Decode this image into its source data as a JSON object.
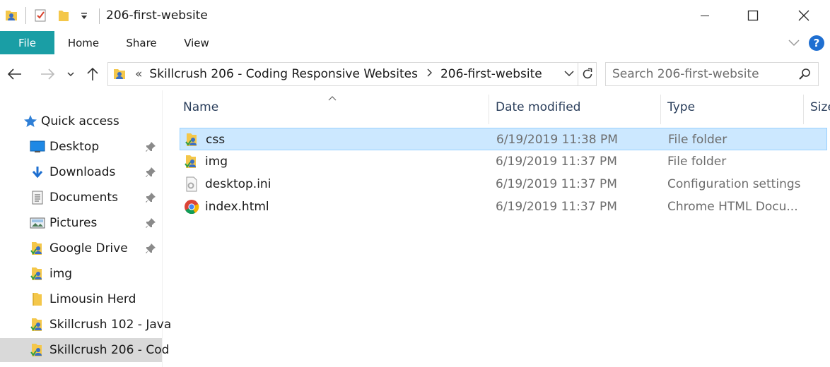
{
  "window": {
    "title": "206-first-website"
  },
  "ribbon": {
    "tabs": [
      "File",
      "Home",
      "Share",
      "View"
    ],
    "help_label": "?"
  },
  "address": {
    "overflow": "«",
    "crumbs": [
      "Skillcrush 206 - Coding Responsive Websites",
      "206-first-website"
    ]
  },
  "search": {
    "placeholder": "Search 206-first-website"
  },
  "navpane": {
    "quick_access": "Quick access",
    "items": [
      {
        "label": "Desktop",
        "icon": "desktop-icon",
        "pinned": true
      },
      {
        "label": "Downloads",
        "icon": "download-arrow-icon",
        "pinned": true
      },
      {
        "label": "Documents",
        "icon": "documents-icon",
        "pinned": true
      },
      {
        "label": "Pictures",
        "icon": "pictures-icon",
        "pinned": true
      },
      {
        "label": "Google Drive",
        "icon": "shared-folder-icon",
        "pinned": true
      },
      {
        "label": "img",
        "icon": "shared-folder-icon",
        "pinned": false
      },
      {
        "label": "Limousin Herd",
        "icon": "folder-icon",
        "pinned": false
      },
      {
        "label": "Skillcrush 102 - Java",
        "icon": "shared-folder-icon",
        "pinned": false
      },
      {
        "label": "Skillcrush 206 - Cod",
        "icon": "shared-folder-icon",
        "pinned": false,
        "selected": true
      }
    ]
  },
  "columns": {
    "name": "Name",
    "date": "Date modified",
    "type": "Type",
    "size": "Size"
  },
  "files": [
    {
      "name": "css",
      "date": "6/19/2019 11:38 PM",
      "type": "File folder",
      "icon": "shared-folder-icon",
      "selected": true
    },
    {
      "name": "img",
      "date": "6/19/2019 11:37 PM",
      "type": "File folder",
      "icon": "shared-folder-icon",
      "selected": false
    },
    {
      "name": "desktop.ini",
      "date": "6/19/2019 11:37 PM",
      "type": "Configuration settings",
      "icon": "settings-file-icon",
      "selected": false
    },
    {
      "name": "index.html",
      "date": "6/19/2019 11:37 PM",
      "type": "Chrome HTML Docu...",
      "icon": "chrome-icon",
      "selected": false
    }
  ],
  "colors": {
    "file_tab": "#1a9ea5",
    "selection": "#cce8ff",
    "nav_selection": "#d9d9d9",
    "header_text": "#2b3f5c"
  }
}
